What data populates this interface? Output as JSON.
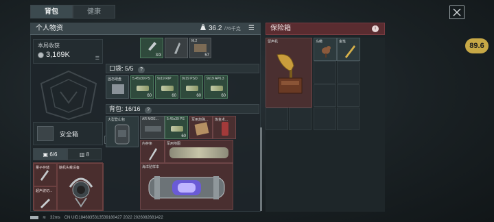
{
  "tabs": [
    {
      "label": "背包"
    },
    {
      "label": "健康"
    }
  ],
  "fps_badge": "89.6",
  "personal": {
    "title": "个人物资",
    "weight": "36.2",
    "weight_max": "/76千克",
    "earnings_label": "本局收获",
    "earnings_value": "3,169K",
    "safebox_label": "安全箱",
    "cap_tabs": [
      {
        "label": "6/6"
      },
      {
        "label": "8"
      }
    ],
    "devices": [
      {
        "label": "量子存储"
      },
      {
        "label": "脑机头戴设备"
      },
      {
        "label": "超声波切..."
      }
    ]
  },
  "top_items": [
    {
      "count": "3/3"
    },
    {
      "count": ""
    },
    {
      "name": "M.2",
      "count": "57"
    }
  ],
  "pocket": {
    "label": "口袋: 5/5",
    "items": [
      {
        "name": "固态硬盘",
        "count": ""
      },
      {
        "name": "5.45x39 PS",
        "count": "60"
      },
      {
        "name": "9x19 RIP",
        "count": "60"
      },
      {
        "name": "9x19 PSO",
        "count": "60"
      },
      {
        "name": "9x19 AP6.3",
        "count": "60"
      }
    ]
  },
  "backpack": {
    "label": "背包: 16/16",
    "items": [
      {
        "name": "大型登山包"
      },
      {
        "name": "AR MOE..."
      },
      {
        "name": "5.45x39 PS",
        "count": "60"
      },
      {
        "name": "军用炮弹..."
      },
      {
        "name": "炼金术..."
      },
      {
        "name": "内存条"
      },
      {
        "name": "军用地图"
      },
      {
        "name": "海洋贴样本"
      }
    ]
  },
  "safe": {
    "title": "保险箱",
    "items": [
      {
        "name": "留声机"
      },
      {
        "name": "鸟瞰"
      },
      {
        "name": "金笔"
      }
    ]
  },
  "status": {
    "ping": "32ms",
    "uid": "CN UID1846835313539180427 2022 2026082681422"
  }
}
